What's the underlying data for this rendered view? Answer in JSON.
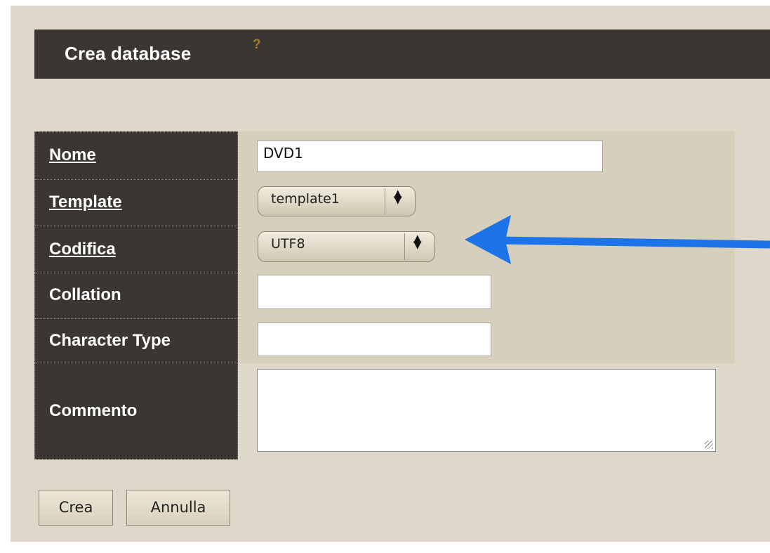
{
  "header": {
    "title": "Crea database",
    "help": "?"
  },
  "form": {
    "nome": {
      "label": "Nome",
      "value": "DVD1"
    },
    "template": {
      "label": "Template",
      "value": "template1"
    },
    "codifica": {
      "label": "Codifica",
      "value": "UTF8"
    },
    "collation": {
      "label": "Collation",
      "value": ""
    },
    "character_type": {
      "label": "Character Type",
      "value": ""
    },
    "commento": {
      "label": "Commento",
      "value": ""
    }
  },
  "buttons": {
    "create": "Crea",
    "cancel": "Annulla"
  },
  "colors": {
    "background": "#ddd8c9",
    "dark": "#3a3631",
    "help": "#a87933",
    "annotation_arrow": "#1c74e8"
  }
}
